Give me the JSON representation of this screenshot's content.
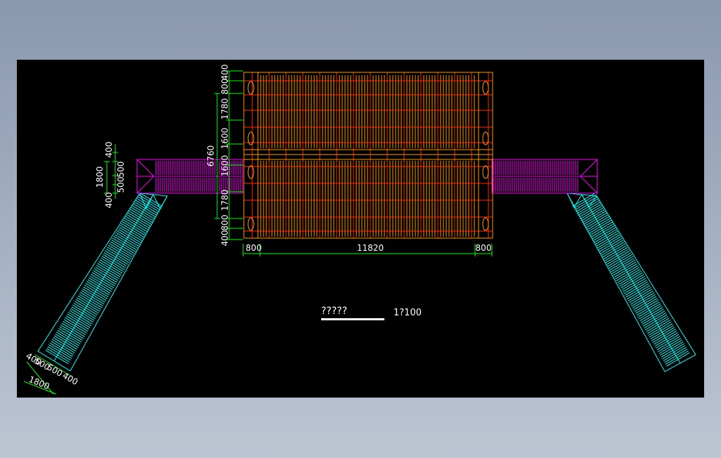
{
  "drawing": {
    "title": "?????",
    "scale": "1?100"
  },
  "dimensions": {
    "overall_height": "6760",
    "left_vertical": [
      "400",
      "800",
      "1780",
      "1600",
      "1600",
      "1780",
      "800",
      "400"
    ],
    "bottom_left": "800",
    "bottom_middle": "11820",
    "bottom_right": "800",
    "corridor_total": "1800",
    "corridor_parts": [
      "400",
      "500",
      "500",
      "400"
    ],
    "ramp_total": "1800",
    "ramp_parts": [
      "400",
      "500",
      "500",
      "400"
    ]
  },
  "colors": {
    "background": "#000000",
    "roof": "#ff9900",
    "roof_red": "#ff2a00",
    "corridor": "#ff00ff",
    "ramp": "#00ffff",
    "dimension": "#00ff00",
    "text": "#ffffff"
  }
}
